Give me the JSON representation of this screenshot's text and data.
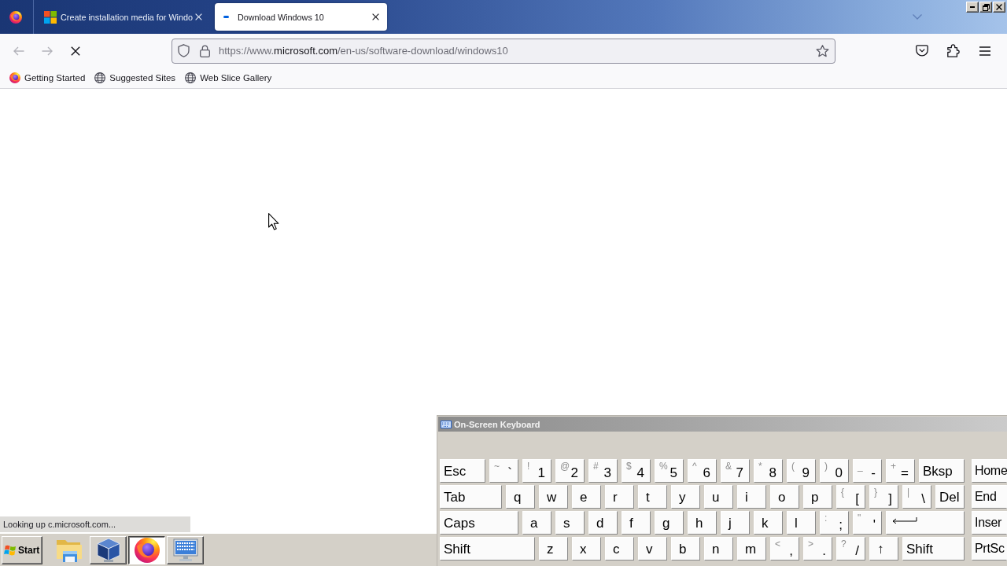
{
  "browser": {
    "tabs": [
      {
        "title": "Create installation media for Windo",
        "selected": false,
        "loading": false
      },
      {
        "title": "Download Windows 10",
        "selected": true,
        "loading": true
      }
    ],
    "navigation": {
      "back": {
        "disabled": true
      },
      "forward": {
        "disabled": true
      },
      "loading": true
    },
    "address_bar": {
      "prefix": "https://www.",
      "domain": "microsoft.com",
      "path": "/en-us/software-download/windows10"
    },
    "bookmarks": [
      {
        "label": "Getting Started",
        "kind": "fox"
      },
      {
        "label": "Suggested Sites",
        "kind": "globe"
      },
      {
        "label": "Web Slice Gallery",
        "kind": "globe"
      }
    ],
    "status_text": "Looking up c.microsoft.com..."
  },
  "on_screen_keyboard": {
    "title": "On-Screen Keyboard",
    "rows": [
      [
        {
          "kind": "word",
          "label": "Esc"
        },
        {
          "kind": "pair",
          "shift": "~",
          "main": "`"
        },
        {
          "kind": "pair",
          "shift": "!",
          "main": "1"
        },
        {
          "kind": "pair",
          "shift": "@",
          "main": "2"
        },
        {
          "kind": "pair",
          "shift": "#",
          "main": "3"
        },
        {
          "kind": "pair",
          "shift": "$",
          "main": "4"
        },
        {
          "kind": "pair",
          "shift": "%",
          "main": "5"
        },
        {
          "kind": "pair",
          "shift": "^",
          "main": "6"
        },
        {
          "kind": "pair",
          "shift": "&",
          "main": "7"
        },
        {
          "kind": "pair",
          "shift": "*",
          "main": "8"
        },
        {
          "kind": "pair",
          "shift": "(",
          "main": "9"
        },
        {
          "kind": "pair",
          "shift": ")",
          "main": "0"
        },
        {
          "kind": "pair",
          "shift": "_",
          "main": "-"
        },
        {
          "kind": "pair",
          "shift": "+",
          "main": "="
        },
        {
          "kind": "word",
          "label": "Bksp"
        }
      ],
      [
        {
          "kind": "word",
          "label": "Tab"
        },
        {
          "kind": "char",
          "label": "q"
        },
        {
          "kind": "char",
          "label": "w"
        },
        {
          "kind": "char",
          "label": "e"
        },
        {
          "kind": "char",
          "label": "r"
        },
        {
          "kind": "char",
          "label": "t"
        },
        {
          "kind": "char",
          "label": "y"
        },
        {
          "kind": "char",
          "label": "u"
        },
        {
          "kind": "char",
          "label": "i"
        },
        {
          "kind": "char",
          "label": "o"
        },
        {
          "kind": "char",
          "label": "p"
        },
        {
          "kind": "pair",
          "shift": "{",
          "main": "["
        },
        {
          "kind": "pair",
          "shift": "}",
          "main": "]"
        },
        {
          "kind": "pair",
          "shift": "|",
          "main": "\\"
        },
        {
          "kind": "word",
          "label": "Del"
        }
      ],
      [
        {
          "kind": "word",
          "label": "Caps"
        },
        {
          "kind": "char",
          "label": "a"
        },
        {
          "kind": "char",
          "label": "s"
        },
        {
          "kind": "char",
          "label": "d"
        },
        {
          "kind": "char",
          "label": "f"
        },
        {
          "kind": "char",
          "label": "g"
        },
        {
          "kind": "char",
          "label": "h"
        },
        {
          "kind": "char",
          "label": "j"
        },
        {
          "kind": "char",
          "label": "k"
        },
        {
          "kind": "char",
          "label": "l"
        },
        {
          "kind": "pair",
          "shift": ":",
          "main": ";"
        },
        {
          "kind": "pair",
          "shift": "\"",
          "main": "'"
        },
        {
          "kind": "enter"
        }
      ],
      [
        {
          "kind": "word",
          "label": "Shift"
        },
        {
          "kind": "char",
          "label": "z"
        },
        {
          "kind": "char",
          "label": "x"
        },
        {
          "kind": "char",
          "label": "c"
        },
        {
          "kind": "char",
          "label": "v"
        },
        {
          "kind": "char",
          "label": "b"
        },
        {
          "kind": "char",
          "label": "n"
        },
        {
          "kind": "char",
          "label": "m"
        },
        {
          "kind": "pair",
          "shift": "<",
          "main": ","
        },
        {
          "kind": "pair",
          "shift": ">",
          "main": "."
        },
        {
          "kind": "pair",
          "shift": "?",
          "main": "/"
        },
        {
          "kind": "char",
          "label": "↑"
        },
        {
          "kind": "word",
          "label": "Shift"
        }
      ]
    ],
    "side_keys": [
      "Home",
      "End",
      "Inser",
      "PrtSc"
    ]
  },
  "taskbar": {
    "start_label": "Start",
    "quick_launch": [
      {
        "kind": "folder"
      }
    ],
    "tasks": [
      {
        "kind": "cube",
        "selected": false
      },
      {
        "kind": "fox",
        "selected": true
      },
      {
        "kind": "keyboard",
        "selected": false
      }
    ]
  }
}
